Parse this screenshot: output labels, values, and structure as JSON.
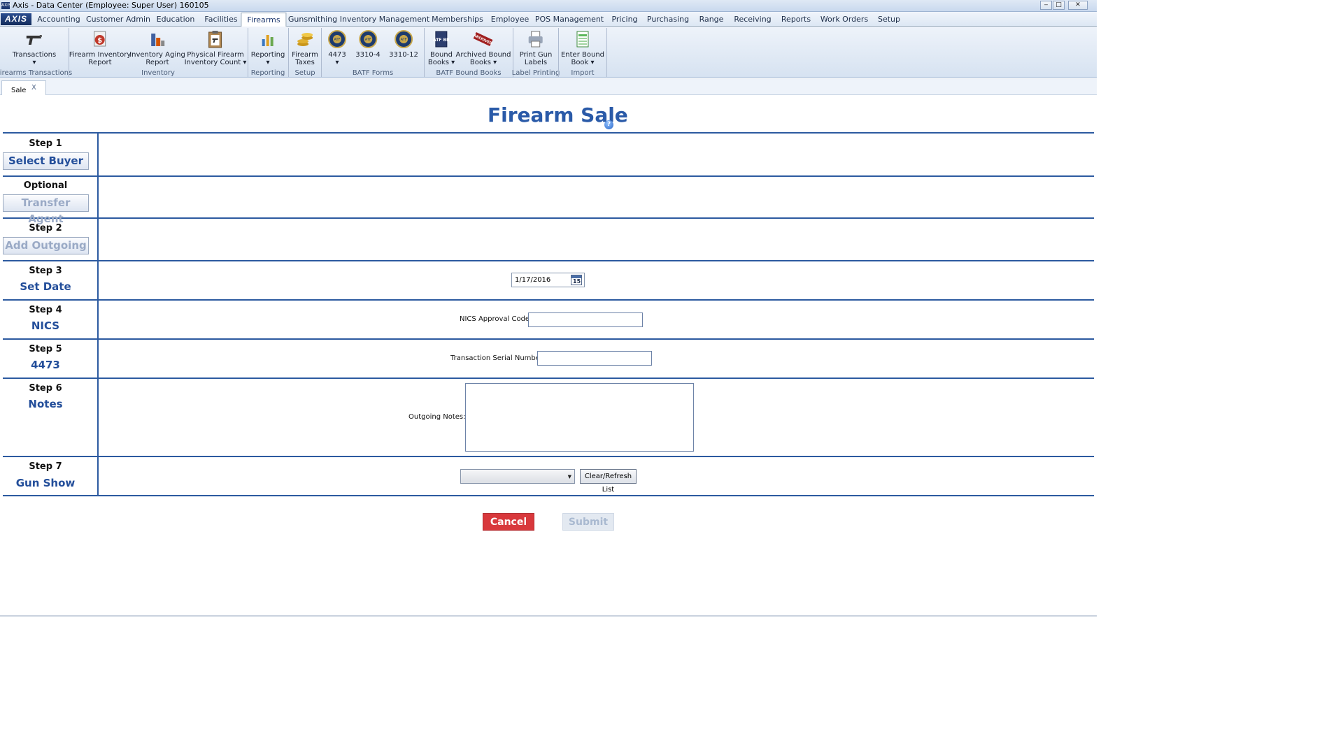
{
  "window": {
    "title": "Axis - Data Center  (Employee: Super User) 160105",
    "app_icon_text": "AXIS",
    "controls": [
      "‒",
      "□",
      "✕"
    ]
  },
  "menu": {
    "logo": "AXIS",
    "items": [
      "Accounting",
      "Customer Admin",
      "Education",
      "Facilities",
      "Firearms",
      "Gunsmithing",
      "Inventory Management",
      "Memberships",
      "Employee",
      "POS Management",
      "Pricing",
      "Purchasing",
      "Range",
      "Receiving",
      "Reports",
      "Work Orders",
      "Setup"
    ],
    "active": "Firearms"
  },
  "ribbon": {
    "buttons": [
      {
        "line1": "Transactions",
        "line2": "▾",
        "icon": "pistol-icon"
      },
      {
        "line1": "Firearm Inventory",
        "line2": "Report",
        "icon": "report-dollar-icon"
      },
      {
        "line1": "Inventory Aging",
        "line2": "Report",
        "icon": "bar-chart-icon"
      },
      {
        "line1": "Physical Firearm",
        "line2": "Inventory Count ▾",
        "icon": "clipboard-pistol-icon"
      },
      {
        "line1": "Reporting",
        "line2": "▾",
        "icon": "reporting-chart-icon"
      },
      {
        "line1": "Firearm",
        "line2": "Taxes",
        "icon": "coins-icon"
      },
      {
        "line1": "4473",
        "line2": "▾",
        "icon": "atf-seal-icon"
      },
      {
        "line1": "3310-4",
        "line2": "",
        "icon": "atf-seal-icon"
      },
      {
        "line1": "3310-12",
        "line2": "",
        "icon": "atf-seal-icon"
      },
      {
        "line1": "Bound",
        "line2": "Books ▾",
        "icon": "bound-book-icon"
      },
      {
        "line1": "Archived Bound",
        "line2": "Books ▾",
        "icon": "archived-stamp-icon"
      },
      {
        "line1": "Print Gun",
        "line2": "Labels",
        "icon": "printer-icon"
      },
      {
        "line1": "Enter Bound",
        "line2": "Book ▾",
        "icon": "spreadsheet-icon"
      }
    ],
    "groups": [
      "Firearms Transactions",
      "Inventory",
      "Reporting",
      "Setup",
      "BATF Forms",
      "BATF Bound Books",
      "Label Printing",
      "Import"
    ],
    "seal_text": "ATF",
    "bound_book_text": "ATF BB",
    "archived_stamp_text": "ARCHIVED"
  },
  "tabs": [
    {
      "label": "Sale",
      "close": "X"
    }
  ],
  "page": {
    "title": "Firearm Sale",
    "help": "?"
  },
  "steps": [
    {
      "label": "Step 1",
      "name": "Select Buyer"
    },
    {
      "label": "Optional",
      "name": "Transfer Agent"
    },
    {
      "label": "Step 2",
      "name": "Add Outgoing"
    },
    {
      "label": "Step 3",
      "name": "Set Date"
    },
    {
      "label": "Step 4",
      "name": "NICS"
    },
    {
      "label": "Step 5",
      "name": "4473"
    },
    {
      "label": "Step 6",
      "name": "Notes"
    },
    {
      "label": "Step 7",
      "name": "Gun Show"
    }
  ],
  "fields": {
    "date_value": "1/17/2016",
    "calendar_day": "15",
    "nics_label": "NICS Approval Code:",
    "nics_value": "",
    "serial_label": "Transaction Serial Number:",
    "serial_value": "",
    "notes_label": "Outgoing Notes:",
    "notes_value": "",
    "gun_show_selected": "",
    "clear_refresh_label": "Clear/Refresh List"
  },
  "actions": {
    "cancel": "Cancel",
    "submit": "Submit"
  },
  "colors": {
    "accent": "#2a5aa8",
    "cancel": "#d8383c",
    "disabled_text": "#9aaac6"
  }
}
